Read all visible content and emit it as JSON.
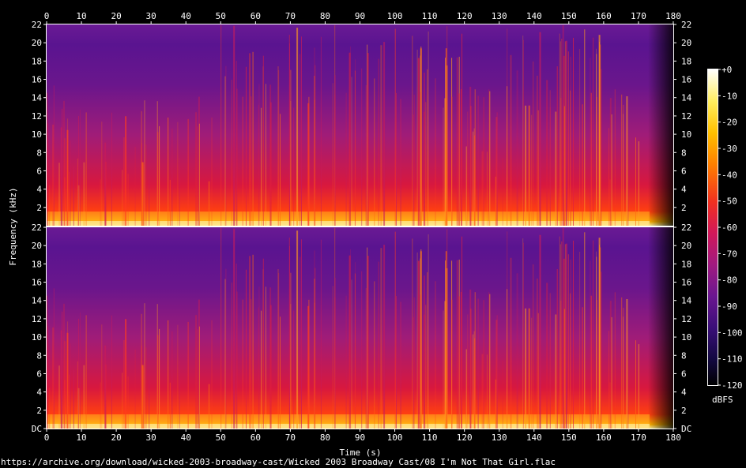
{
  "chart_data": {
    "type": "heatmap",
    "xlabel": "Time (s)",
    "ylabel": "Frequency (kHz)",
    "xlim": [
      0,
      180
    ],
    "ylim": [
      0,
      22
    ],
    "x_ticks": [
      "0",
      "10",
      "20",
      "30",
      "40",
      "50",
      "60",
      "70",
      "80",
      "90",
      "100",
      "110",
      "120",
      "130",
      "140",
      "150",
      "160",
      "170",
      "180"
    ],
    "y_ticks": [
      "2",
      "4",
      "6",
      "8",
      "10",
      "12",
      "14",
      "16",
      "18",
      "20",
      "22"
    ],
    "y_tick_bottom": "DC",
    "colorbar": {
      "label": "dBFS",
      "range": [
        -120,
        0
      ],
      "ticks": [
        "+0",
        "-10",
        "-20",
        "-30",
        "-40",
        "-50",
        "-60",
        "-70",
        "-80",
        "-90",
        "-100",
        "-110",
        "-120"
      ],
      "colormap": [
        "#000000",
        "#1a0a4a",
        "#3c0f7a",
        "#6a1a8c",
        "#9b1f86",
        "#c8226a",
        "#e8333a",
        "#ff5a10",
        "#ffa000",
        "#ffe040",
        "#ffffff"
      ]
    },
    "channels": 2,
    "panels": [
      {
        "channel": "top"
      },
      {
        "channel": "bottom"
      }
    ]
  },
  "footer": {
    "source": "https://archive.org/download/wicked-2003-broadway-cast/Wicked 2003 Broadway Cast/08 I'm Not That Girl.flac"
  }
}
